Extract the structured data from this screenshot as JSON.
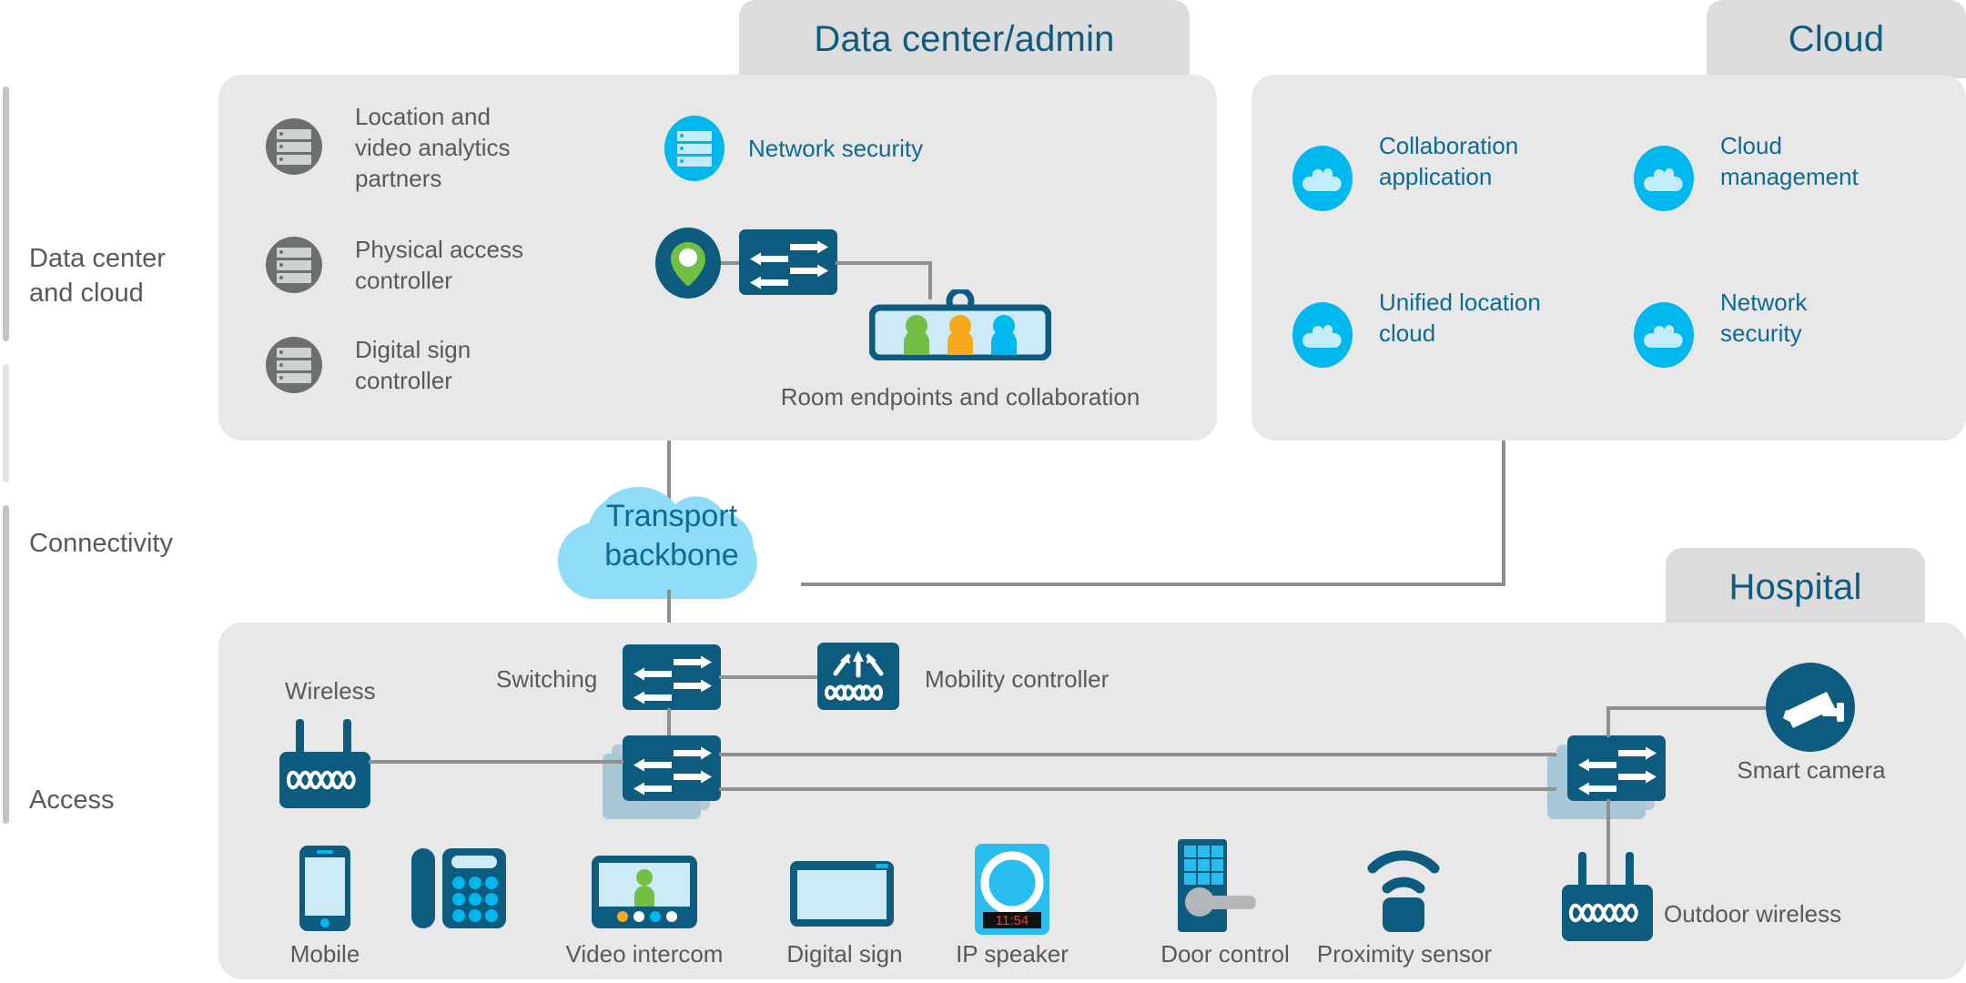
{
  "rail": {
    "items": [
      {
        "label": "Data center\nand cloud",
        "name": "data-center-and-cloud"
      },
      {
        "label": "Connectivity",
        "name": "connectivity"
      },
      {
        "label": "Access",
        "name": "access"
      }
    ]
  },
  "panels": {
    "data_center": {
      "tab": "Data center/admin"
    },
    "cloud": {
      "tab": "Cloud"
    },
    "hospital": {
      "tab": "Hospital"
    }
  },
  "data_center": {
    "servers": [
      {
        "label": "Location and\nvideo analytics\npartners",
        "icon": "server-icon",
        "color": "#6d6e70"
      },
      {
        "label": "Physical access\ncontroller",
        "icon": "server-icon",
        "color": "#6d6e70"
      },
      {
        "label": "Digital sign\ncontroller",
        "icon": "server-icon",
        "color": "#6d6e70"
      }
    ],
    "network_security": {
      "label": "Network security",
      "icon": "server-icon",
      "color": "#00b7ee"
    },
    "location_pin": {
      "icon": "location-pin-icon",
      "color": "#0d5c80"
    },
    "switch": {
      "icon": "switch-icon",
      "color": "#0d5c80"
    },
    "room_endpoints": {
      "label": "Room endpoints and collaboration",
      "icon": "room-endpoint-icon"
    }
  },
  "cloud": {
    "items": [
      {
        "label": "Collaboration\napplication",
        "icon": "cloud-icon"
      },
      {
        "label": "Cloud\nmanagement",
        "icon": "cloud-icon"
      },
      {
        "label": "Unified location\ncloud",
        "icon": "cloud-icon"
      },
      {
        "label": "Network\nsecurity",
        "icon": "cloud-icon"
      }
    ]
  },
  "connectivity": {
    "transport_backbone": {
      "label": "Transport\nbackbone",
      "icon": "cloud-shape",
      "color": "#8fdcf8"
    }
  },
  "access": {
    "wireless": {
      "label": "Wireless",
      "icon": "access-point-icon"
    },
    "switching": {
      "label": "Switching",
      "icon": "switch-icon"
    },
    "mobility_controller": {
      "label": "Mobility controller",
      "icon": "mobility-controller-icon"
    },
    "smart_camera": {
      "label": "Smart camera",
      "icon": "camera-icon"
    },
    "outdoor_wireless": {
      "label": "Outdoor wireless",
      "icon": "access-point-icon"
    },
    "endpoints": [
      {
        "label": "Mobile",
        "icon": "mobile-phone-icon"
      },
      {
        "label": "",
        "icon": "desk-phone-icon"
      },
      {
        "label": "Video intercom",
        "icon": "video-intercom-icon"
      },
      {
        "label": "Digital sign",
        "icon": "digital-sign-icon"
      },
      {
        "label": "IP speaker",
        "icon": "ip-speaker-icon",
        "display": "11:54"
      },
      {
        "label": "Door control",
        "icon": "door-lock-icon",
        "keys": "1 2 3 4 5 6 7 8 9"
      },
      {
        "label": "Proximity sensor",
        "icon": "proximity-sensor-icon"
      }
    ]
  },
  "colors": {
    "panel_bg": "#e8e8e8",
    "tab_bg": "#dcdcdc",
    "dark_blue": "#0d5c80",
    "cyan": "#00b7ee",
    "light_cyan": "#8fdcf8",
    "line": "#8d8f91",
    "text_gray": "#58595b",
    "text_blue": "#0d6a92",
    "green": "#72bf44",
    "orange": "#f7a81b"
  }
}
